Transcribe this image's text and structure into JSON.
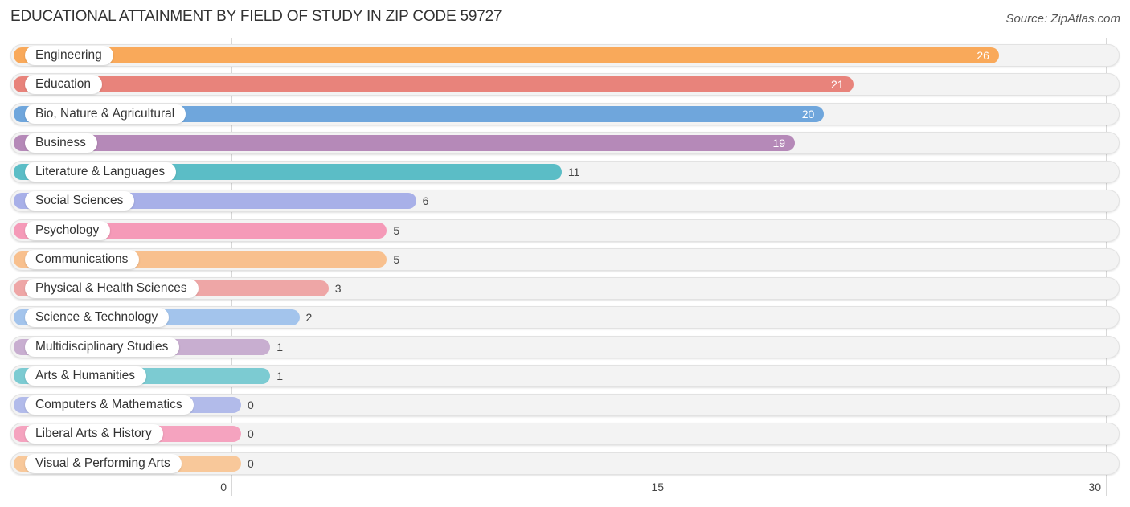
{
  "header": {
    "title": "EDUCATIONAL ATTAINMENT BY FIELD OF STUDY IN ZIP CODE 59727",
    "source": "Source: ZipAtlas.com"
  },
  "chart_data": {
    "type": "bar",
    "orientation": "horizontal",
    "title": "EDUCATIONAL ATTAINMENT BY FIELD OF STUDY IN ZIP CODE 59727",
    "xlabel": "",
    "ylabel": "",
    "xlim": [
      0,
      30
    ],
    "grid": true,
    "ticks": [
      "0",
      "15",
      "30"
    ],
    "tick_values": [
      0,
      15,
      30
    ],
    "categories": [
      "Engineering",
      "Education",
      "Bio, Nature & Agricultural",
      "Business",
      "Literature & Languages",
      "Social Sciences",
      "Psychology",
      "Communications",
      "Physical & Health Sciences",
      "Science & Technology",
      "Multidisciplinary Studies",
      "Arts & Humanities",
      "Computers & Mathematics",
      "Liberal Arts & History",
      "Visual & Performing Arts"
    ],
    "values": [
      26,
      21,
      20,
      19,
      11,
      6,
      5,
      5,
      3,
      2,
      1,
      1,
      0,
      0,
      0
    ],
    "value_labels": [
      "26",
      "21",
      "20",
      "19",
      "11",
      "6",
      "5",
      "5",
      "3",
      "2",
      "1",
      "1",
      "0",
      "0",
      "0"
    ],
    "colors": [
      "#f9a95a",
      "#e8837b",
      "#6fa6dc",
      "#b589b8",
      "#5bbdc6",
      "#a8b0e8",
      "#f59ab8",
      "#f8c08e",
      "#eea6a6",
      "#a3c4ec",
      "#c8aed0",
      "#7ccbd2",
      "#b2bbea",
      "#f5a3bf",
      "#f8c89a"
    ]
  }
}
